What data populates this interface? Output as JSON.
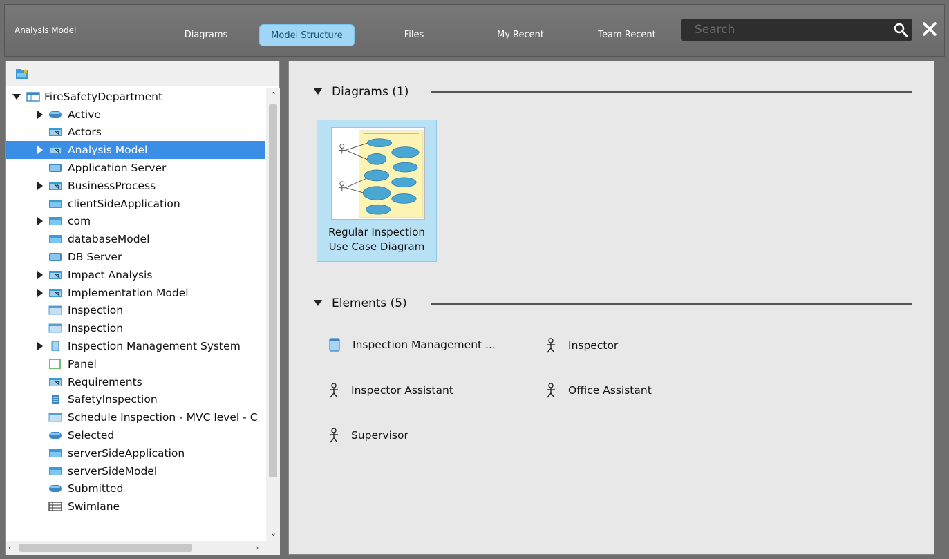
{
  "header": {
    "context_title": "Analysis Model",
    "tabs": [
      {
        "label": "Diagrams"
      },
      {
        "label": "Model Structure"
      },
      {
        "label": "Files"
      },
      {
        "label": "My Recent"
      },
      {
        "label": "Team Recent"
      }
    ],
    "search_placeholder": "Search"
  },
  "tree": {
    "root": "FireSafetyDepartment",
    "items": [
      {
        "label": "Active",
        "icon": "state-icon"
      },
      {
        "label": "Actors",
        "icon": "model-package-icon"
      },
      {
        "label": "Analysis Model",
        "icon": "model-package-icon"
      },
      {
        "label": "Application Server",
        "icon": "node-icon"
      },
      {
        "label": "BusinessProcess",
        "icon": "model-package-icon"
      },
      {
        "label": "clientSideApplication",
        "icon": "package-icon"
      },
      {
        "label": "com",
        "icon": "package-icon"
      },
      {
        "label": "databaseModel",
        "icon": "package-icon"
      },
      {
        "label": "DB Server",
        "icon": "node-icon"
      },
      {
        "label": "Impact Analysis",
        "icon": "model-package-icon"
      },
      {
        "label": "Implementation Model",
        "icon": "model-package-icon"
      },
      {
        "label": "Inspection",
        "icon": "class-icon"
      },
      {
        "label": "Inspection",
        "icon": "class-icon"
      },
      {
        "label": "Inspection Management System",
        "icon": "system-icon"
      },
      {
        "label": "Panel",
        "icon": "panel-icon"
      },
      {
        "label": "Requirements",
        "icon": "model-package-icon"
      },
      {
        "label": "SafetyInspection",
        "icon": "artifact-icon"
      },
      {
        "label": "Schedule Inspection - MVC level - C",
        "icon": "class-icon"
      },
      {
        "label": "Selected",
        "icon": "state-icon"
      },
      {
        "label": "serverSideApplication",
        "icon": "package-icon"
      },
      {
        "label": "serverSideModel",
        "icon": "package-icon"
      },
      {
        "label": "Submitted",
        "icon": "state-icon"
      },
      {
        "label": "Swimlane",
        "icon": "swimlane-icon"
      }
    ]
  },
  "main": {
    "diagrams_header": "Diagrams (1)",
    "diagram": {
      "label_line1": "Regular Inspection",
      "label_line2": "Use Case Diagram"
    },
    "elements_header": "Elements (5)",
    "elements": [
      {
        "label": "Inspection Management ...",
        "icon": "system-icon"
      },
      {
        "label": "Inspector",
        "icon": "actor-icon"
      },
      {
        "label": "Inspector Assistant",
        "icon": "actor-icon"
      },
      {
        "label": "Office Assistant",
        "icon": "actor-icon"
      },
      {
        "label": "Supervisor",
        "icon": "actor-icon"
      }
    ]
  }
}
